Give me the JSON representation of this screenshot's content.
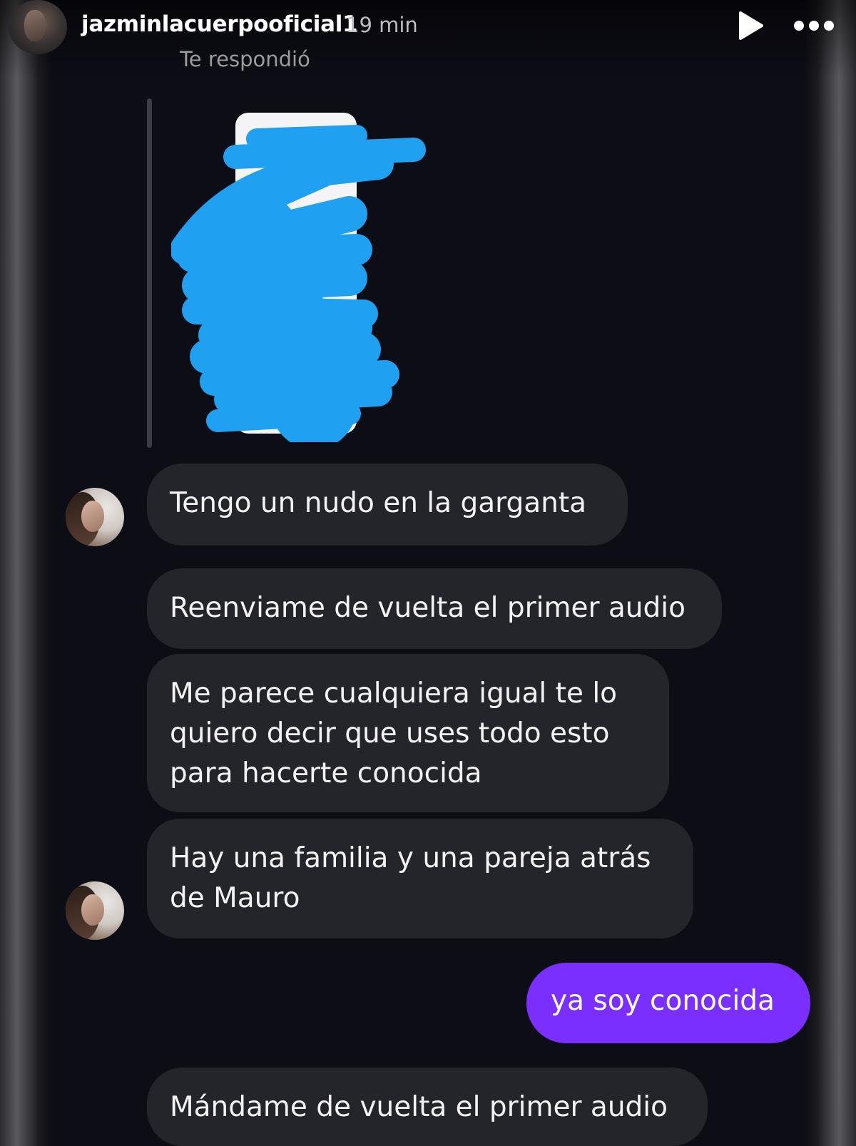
{
  "header": {
    "username": "jazminlacuerpooficial1",
    "time": "19 min",
    "subtitle": "Te respondió",
    "icons": {
      "play": "play-icon",
      "more": "more-options-icon"
    }
  },
  "colors": {
    "background": "#0d0d16",
    "incoming_bubble": "#24242b",
    "outgoing_bubble": "#7a2fff",
    "redaction": "#1fa0f0"
  },
  "messages": [
    {
      "id": "m1",
      "direction": "incoming",
      "lines": [
        "Tengo un nudo en la garganta"
      ]
    },
    {
      "id": "m2",
      "direction": "incoming",
      "lines": [
        "Reenviame de vuelta el primer audio"
      ]
    },
    {
      "id": "m3",
      "direction": "incoming",
      "lines": [
        "Me parece cualquiera igual te lo",
        "quiero decir que uses todo esto",
        "para hacerte conocida"
      ]
    },
    {
      "id": "m4",
      "direction": "incoming",
      "lines": [
        "Hay una familia y una pareja atrás",
        "de Mauro"
      ]
    },
    {
      "id": "m5",
      "direction": "outgoing",
      "lines": [
        "ya soy conocida"
      ]
    },
    {
      "id": "m6",
      "direction": "incoming",
      "lines": [
        "Mándame de vuelta el primer audio"
      ]
    }
  ]
}
